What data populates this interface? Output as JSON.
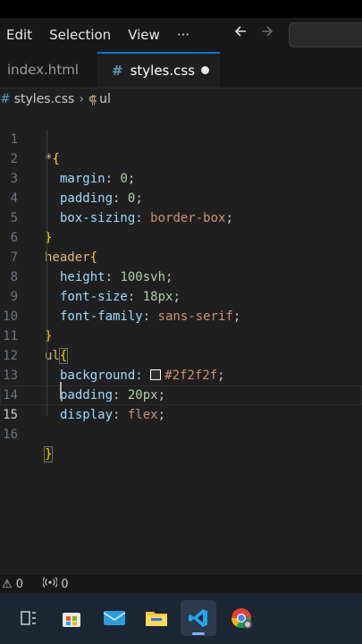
{
  "menu": {
    "items": [
      "Edit",
      "Selection",
      "View"
    ],
    "more_label": "···",
    "back_icon": "arrow-left-icon",
    "forward_icon": "arrow-right-icon"
  },
  "tabs": [
    {
      "label": "index.html",
      "active": false
    },
    {
      "label": "styles.css",
      "active": true,
      "icon": "#"
    }
  ],
  "breadcrumb": {
    "file": "styles.css",
    "file_icon": "#",
    "symbol": "ul"
  },
  "editor": {
    "current_line": 15,
    "lines": [
      {
        "n": "1"
      },
      {
        "n": "2"
      },
      {
        "n": "3"
      },
      {
        "n": "4"
      },
      {
        "n": "5"
      },
      {
        "n": "6"
      },
      {
        "n": "7"
      },
      {
        "n": "8"
      },
      {
        "n": "9"
      },
      {
        "n": "10"
      },
      {
        "n": "11"
      },
      {
        "n": "12"
      },
      {
        "n": "13"
      },
      {
        "n": "14"
      },
      {
        "n": "15"
      },
      {
        "n": "16"
      }
    ],
    "tokens": {
      "l1": [
        "*",
        "{"
      ],
      "l2": [
        "margin",
        ": ",
        "0",
        ";"
      ],
      "l3": [
        "padding",
        ": ",
        "0",
        ";"
      ],
      "l4": [
        "box-sizing",
        ": ",
        "border-box",
        ";"
      ],
      "l5": [
        "}"
      ],
      "l6": [
        "header",
        "{"
      ],
      "l7": [
        "height",
        ": ",
        "100svh",
        ";"
      ],
      "l8": [
        "font-size",
        ": ",
        "18px",
        ";"
      ],
      "l9": [
        "font-family",
        ": ",
        "sans-serif",
        ";"
      ],
      "l10": [
        "}"
      ],
      "l11": [
        "ul",
        "{"
      ],
      "l12": [
        "background",
        ": ",
        "#2f2f2f",
        ";"
      ],
      "l13": [
        "padding",
        ": ",
        "20px",
        ";"
      ],
      "l14": [
        "display",
        ": ",
        "flex",
        ";"
      ],
      "l16": [
        "}"
      ]
    }
  },
  "status": {
    "errors": "0",
    "ports": "0"
  },
  "taskbar": {
    "items": [
      "task-view-icon",
      "store-icon",
      "mail-icon",
      "file-explorer-icon",
      "vscode-icon",
      "chrome-icon"
    ]
  },
  "colors": {
    "accent": "#0078d4",
    "swatch": "#2f2f2f"
  }
}
